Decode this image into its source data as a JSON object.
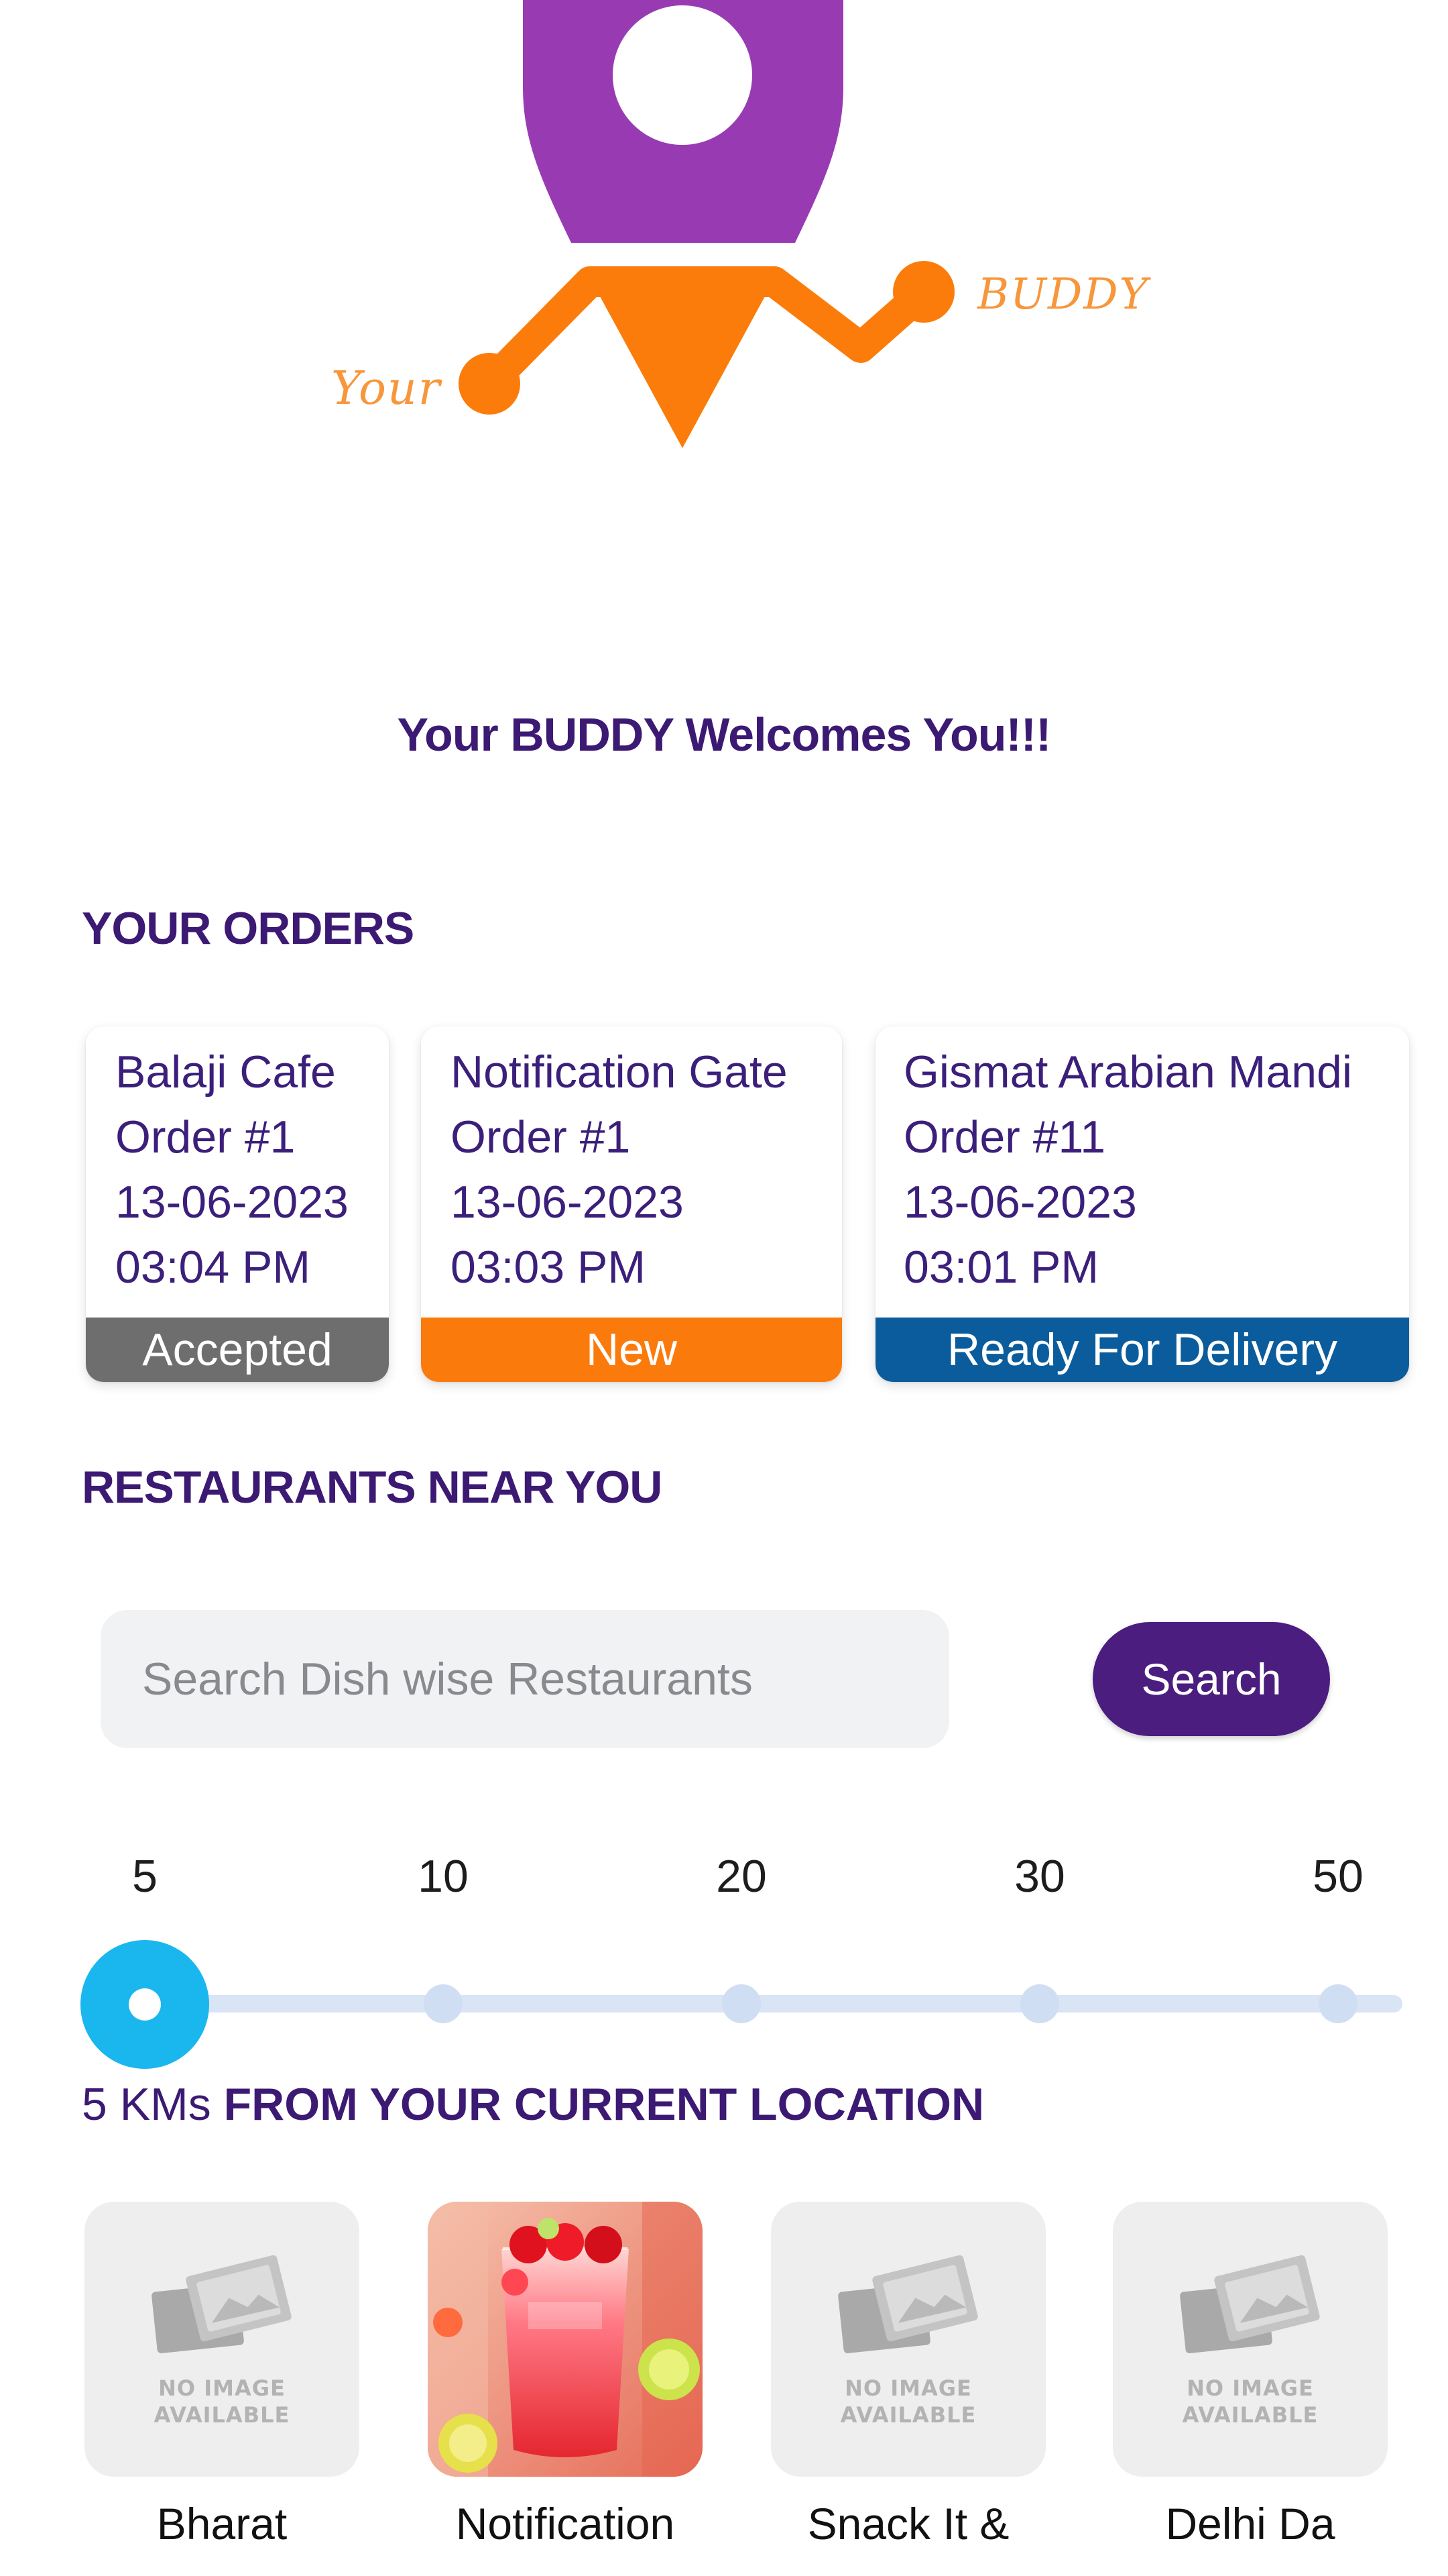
{
  "logo": {
    "word_left": "Your",
    "word_right": "BUDDY"
  },
  "welcome": "Your BUDDY Welcomes You!!!",
  "orders_section": {
    "title": "YOUR ORDERS",
    "orders": [
      {
        "restaurant": "Balaji Cafe",
        "order": "Order #1",
        "date": "13-06-2023",
        "time": "03:04 PM",
        "status": "Accepted",
        "status_color": "#6e6e6e"
      },
      {
        "restaurant": "Notification Gate",
        "order": "Order #1",
        "date": "13-06-2023",
        "time": "03:03 PM",
        "status": "New",
        "status_color": "#fb7a0c"
      },
      {
        "restaurant": "Gismat Arabian Mandi",
        "order": "Order #11",
        "date": "13-06-2023",
        "time": "03:01 PM",
        "status": "Ready For Delivery",
        "status_color": "#0b5c9c"
      }
    ]
  },
  "restaurants_section": {
    "title": "RESTAURANTS NEAR YOU",
    "search": {
      "placeholder": "Search Dish wise Restaurants",
      "value": "",
      "button_label": "Search"
    },
    "distance": {
      "options": [
        "5",
        "10",
        "20",
        "30",
        "50"
      ],
      "selected": "5",
      "selected_prefix": "5 KMs",
      "selected_suffix": " FROM YOUR CURRENT LOCATION"
    },
    "no_image_text": [
      "NO IMAGE",
      "AVAILABLE"
    ],
    "restaurants": [
      {
        "name": "Bharat",
        "image": "no-image"
      },
      {
        "name": "Notification",
        "image": "drink-photo"
      },
      {
        "name": "Snack It &",
        "image": "no-image"
      },
      {
        "name": "Delhi Da",
        "image": "no-image"
      }
    ]
  },
  "colors": {
    "brand_purple": "#4a1d7f",
    "logo_purple": "#983bb3",
    "logo_orange": "#fb7c0a",
    "slider_accent": "#1ab7ee"
  }
}
